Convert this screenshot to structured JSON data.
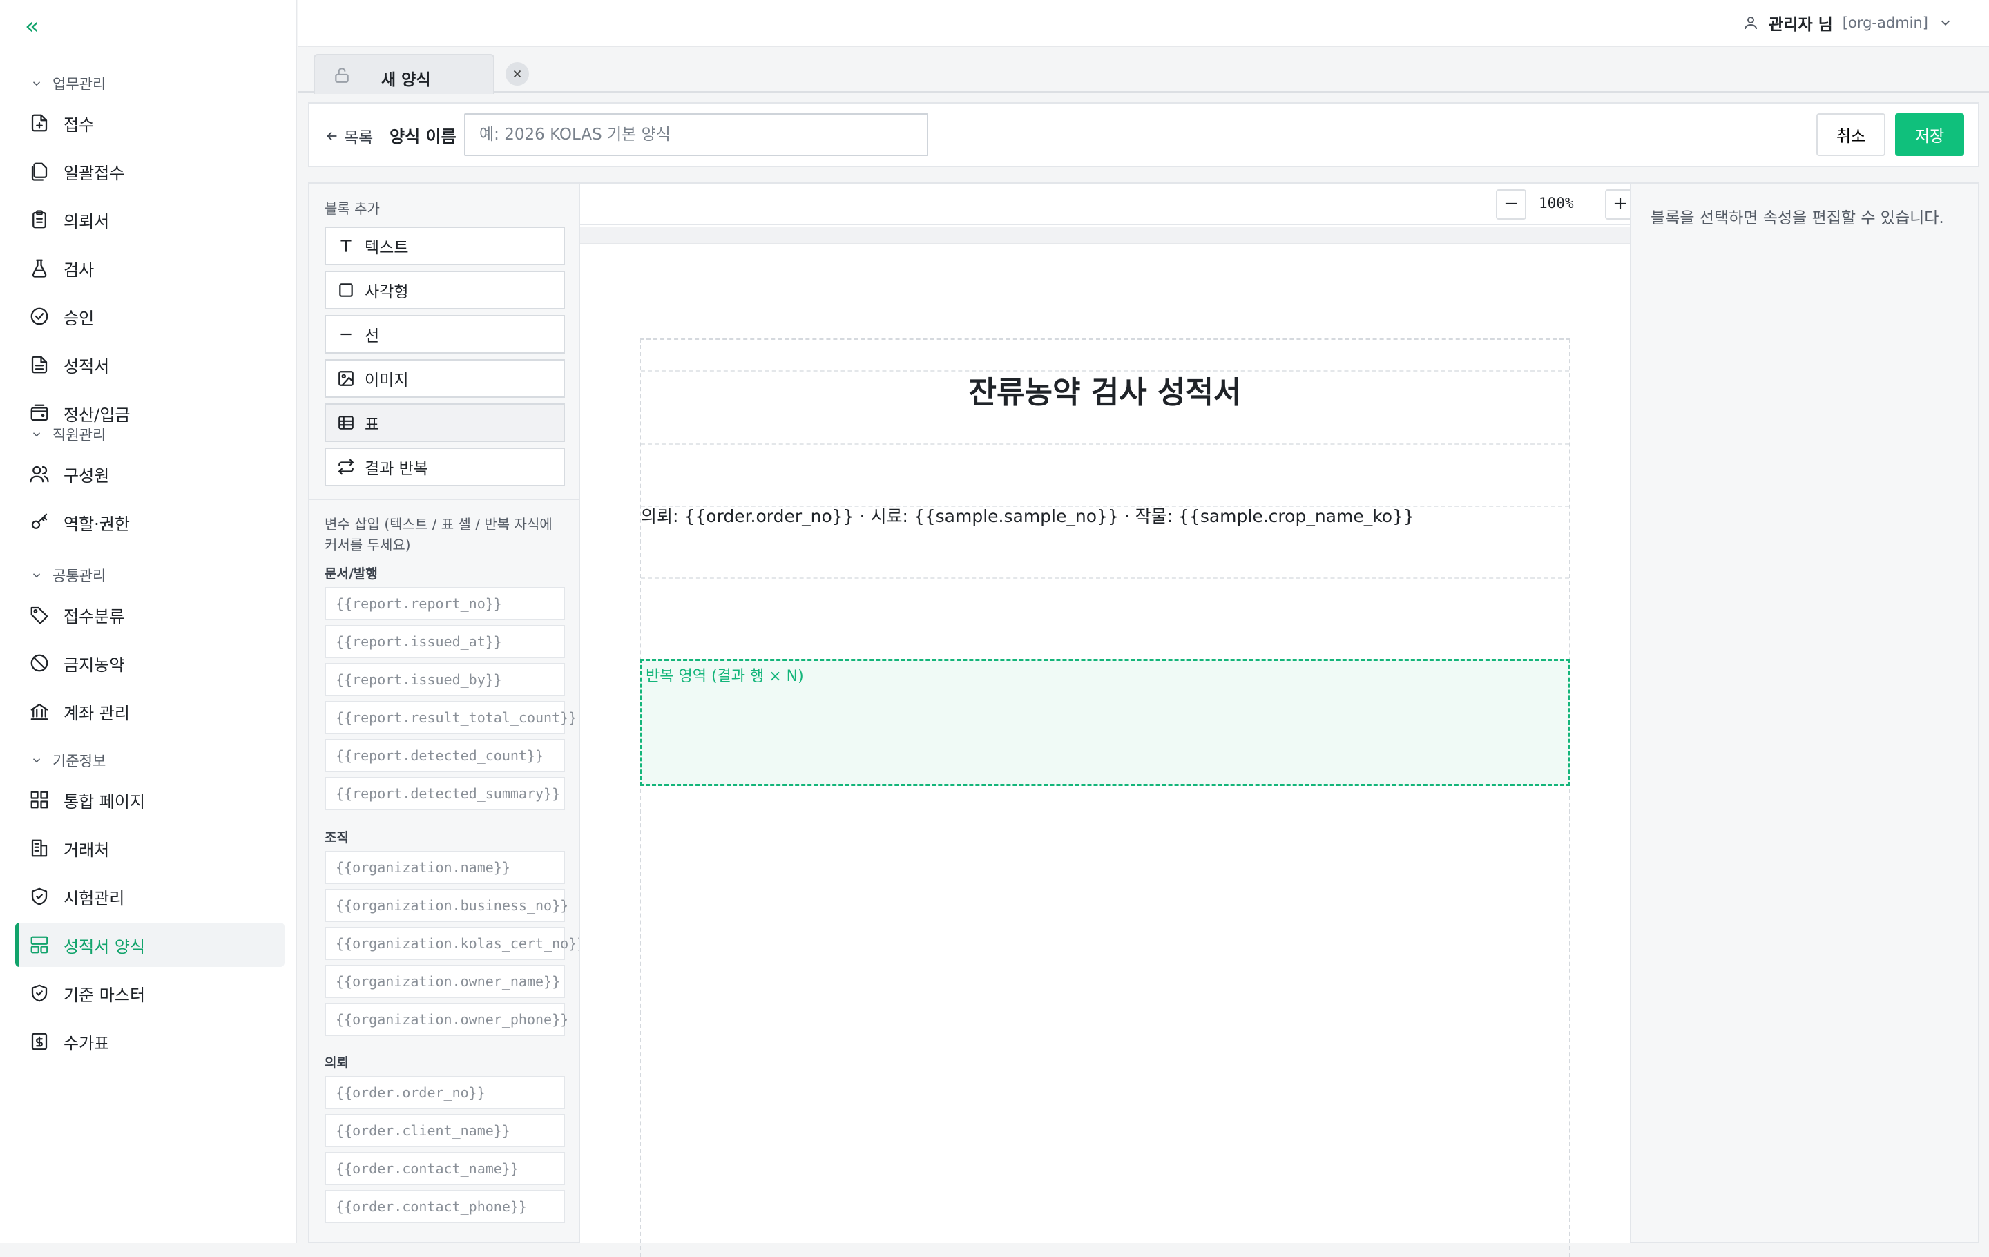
{
  "sidebar": {
    "sections": [
      {
        "label": "업무관리",
        "items": [
          {
            "label": "접수",
            "icon": "file-plus-icon"
          },
          {
            "label": "일괄접수",
            "icon": "files-icon"
          },
          {
            "label": "의뢰서",
            "icon": "clipboard-icon"
          },
          {
            "label": "검사",
            "icon": "flask-icon"
          },
          {
            "label": "승인",
            "icon": "check-circle-icon"
          },
          {
            "label": "성적서",
            "icon": "file-text-icon"
          },
          {
            "label": "정산/입금",
            "icon": "wallet-icon"
          }
        ]
      },
      {
        "label": "직원관리",
        "items": [
          {
            "label": "구성원",
            "icon": "users-icon"
          },
          {
            "label": "역할·권한",
            "icon": "key-icon"
          }
        ]
      },
      {
        "label": "공통관리",
        "items": [
          {
            "label": "접수분류",
            "icon": "tags-icon"
          },
          {
            "label": "금지농약",
            "icon": "ban-icon"
          },
          {
            "label": "계좌 관리",
            "icon": "bank-icon"
          }
        ]
      },
      {
        "label": "기준정보",
        "items": [
          {
            "label": "통합 페이지",
            "icon": "grid-icon"
          },
          {
            "label": "거래처",
            "icon": "building-icon"
          },
          {
            "label": "시험관리",
            "icon": "shield-check-icon"
          },
          {
            "label": "성적서 양식",
            "icon": "layout-template-icon"
          },
          {
            "label": "기준 마스터",
            "icon": "shield-icon"
          },
          {
            "label": "수가표",
            "icon": "price-sheet-icon"
          }
        ]
      }
    ],
    "active": "성적서 양식"
  },
  "header": {
    "user_name": "관리자 님",
    "user_role": "[org-admin]"
  },
  "tabs": [
    {
      "label": "새 양식"
    }
  ],
  "form": {
    "back_label": "목록",
    "name_label": "양식 이름",
    "name_placeholder": "예: 2026 KOLAS 기본 양식",
    "cancel_label": "취소",
    "save_label": "저장"
  },
  "blocks": {
    "title": "블록 추가",
    "items": [
      {
        "label": "텍스트",
        "icon": "text-icon"
      },
      {
        "label": "사각형",
        "icon": "square-icon"
      },
      {
        "label": "선",
        "icon": "line-icon"
      },
      {
        "label": "이미지",
        "icon": "image-icon"
      },
      {
        "label": "표",
        "icon": "table-icon"
      },
      {
        "label": "결과 반복",
        "icon": "repeat-icon"
      }
    ]
  },
  "variables": {
    "title": "변수 삽입 (텍스트 / 표 셀 / 반복 자식에 커서를 두세요)",
    "groups": [
      {
        "label": "문서/발행",
        "items": [
          "{{report.report_no}}",
          "{{report.issued_at}}",
          "{{report.issued_by}}",
          "{{report.result_total_count}}",
          "{{report.detected_count}}",
          "{{report.detected_summary}}"
        ]
      },
      {
        "label": "조직",
        "items": [
          "{{organization.name}}",
          "{{organization.business_no}}",
          "{{organization.kolas_cert_no}}",
          "{{organization.owner_name}}",
          "{{organization.owner_phone}}"
        ]
      },
      {
        "label": "의뢰",
        "items": [
          "{{order.order_no}}",
          "{{order.client_name}}",
          "{{order.contact_name}}",
          "{{order.contact_phone}}"
        ]
      }
    ]
  },
  "canvas": {
    "zoom": "100%",
    "doc_title": "잔류농약 검사 성적서",
    "info_line": "의뢰: {{order.order_no}}  ·  시료: {{sample.sample_no}}  ·  작물: {{sample.crop_name_ko}}",
    "repeat_label": "반복 영역 (결과 행 × N)"
  },
  "properties": {
    "hint": "블록을 선택하면 속성을 편집할 수 있습니다."
  },
  "colors": {
    "accent": "#10c07c",
    "active_text": "#11a36b"
  }
}
